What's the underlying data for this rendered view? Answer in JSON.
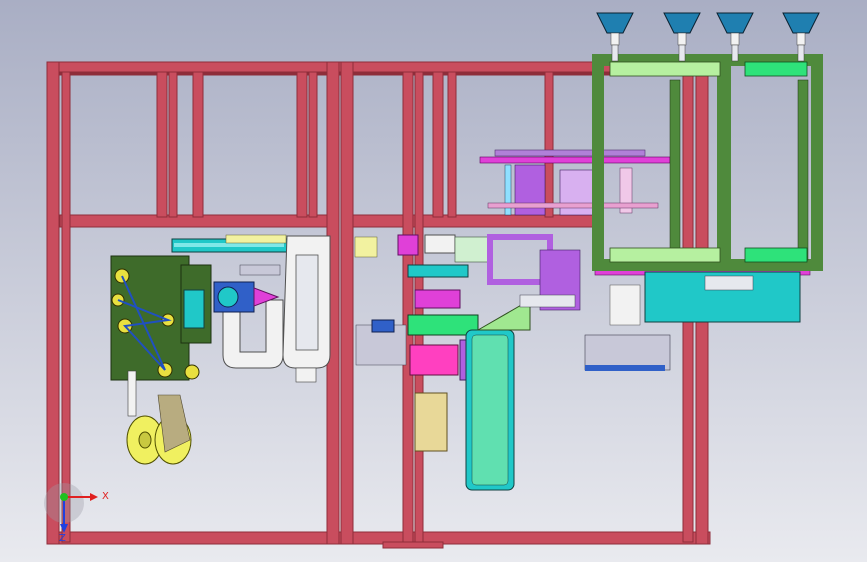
{
  "viewport": {
    "background_top": "#a9aec4",
    "background_bottom": "#e9eaef"
  },
  "colors": {
    "frame": "#c94d5e",
    "frame_dark": "#8e2d3a",
    "green_frame": "#4f8a3c",
    "light_green": "#b6f0a0",
    "bright_green": "#2ee27a",
    "cyan": "#20c8c8",
    "magenta": "#e040d8",
    "purple": "#b060e0",
    "yellow": "#f2f26a",
    "olive": "#3e6b2a",
    "white_part": "#f2f2f2",
    "hopper_blue": "#1f7fb0"
  },
  "triad": {
    "x_label": "X",
    "z_label": "Z",
    "x_color": "#e02020",
    "y_color": "#20c020",
    "z_color": "#2040e0"
  },
  "icons": {
    "triad": "axis-triad-icon",
    "hopper": "funnel-hopper-icon"
  }
}
